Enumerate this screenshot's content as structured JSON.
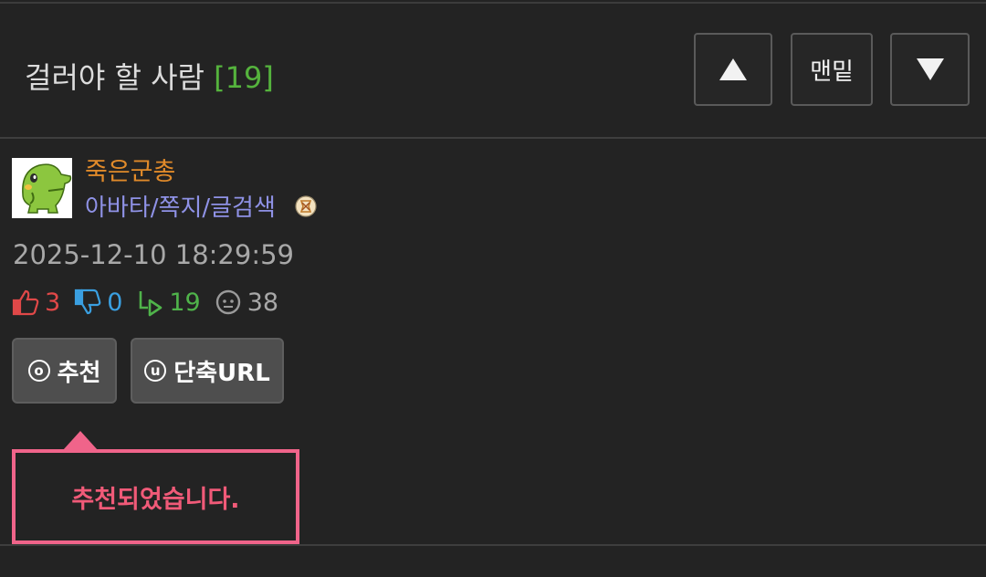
{
  "header": {
    "title": "걸러야 할 사람",
    "comment_count": "[19]",
    "bottom_label": "맨밑",
    "up_icon": "triangle-up-icon",
    "down_icon": "triangle-down-icon"
  },
  "post": {
    "author": "죽은군총",
    "author_links": "아바타/쪽지/글검색",
    "date": "2025-12-10 18:29:59",
    "stats": {
      "upvotes": "3",
      "downvotes": "0",
      "shares": "19",
      "views": "38"
    }
  },
  "actions": {
    "recommend_icon_letter": "o",
    "recommend_label": "추천",
    "shorturl_icon_letter": "u",
    "shorturl_label": "단축URL"
  },
  "toast": {
    "message": "추천되었습니다."
  },
  "colors": {
    "background": "#232323",
    "count_green": "#55b33d",
    "author_orange": "#e08a2a",
    "link_purple": "#8f92e6",
    "upvote_red": "#e04848",
    "downvote_blue": "#3a9fe0",
    "share_green": "#4fb34a",
    "toast_pink": "#f0648a"
  }
}
